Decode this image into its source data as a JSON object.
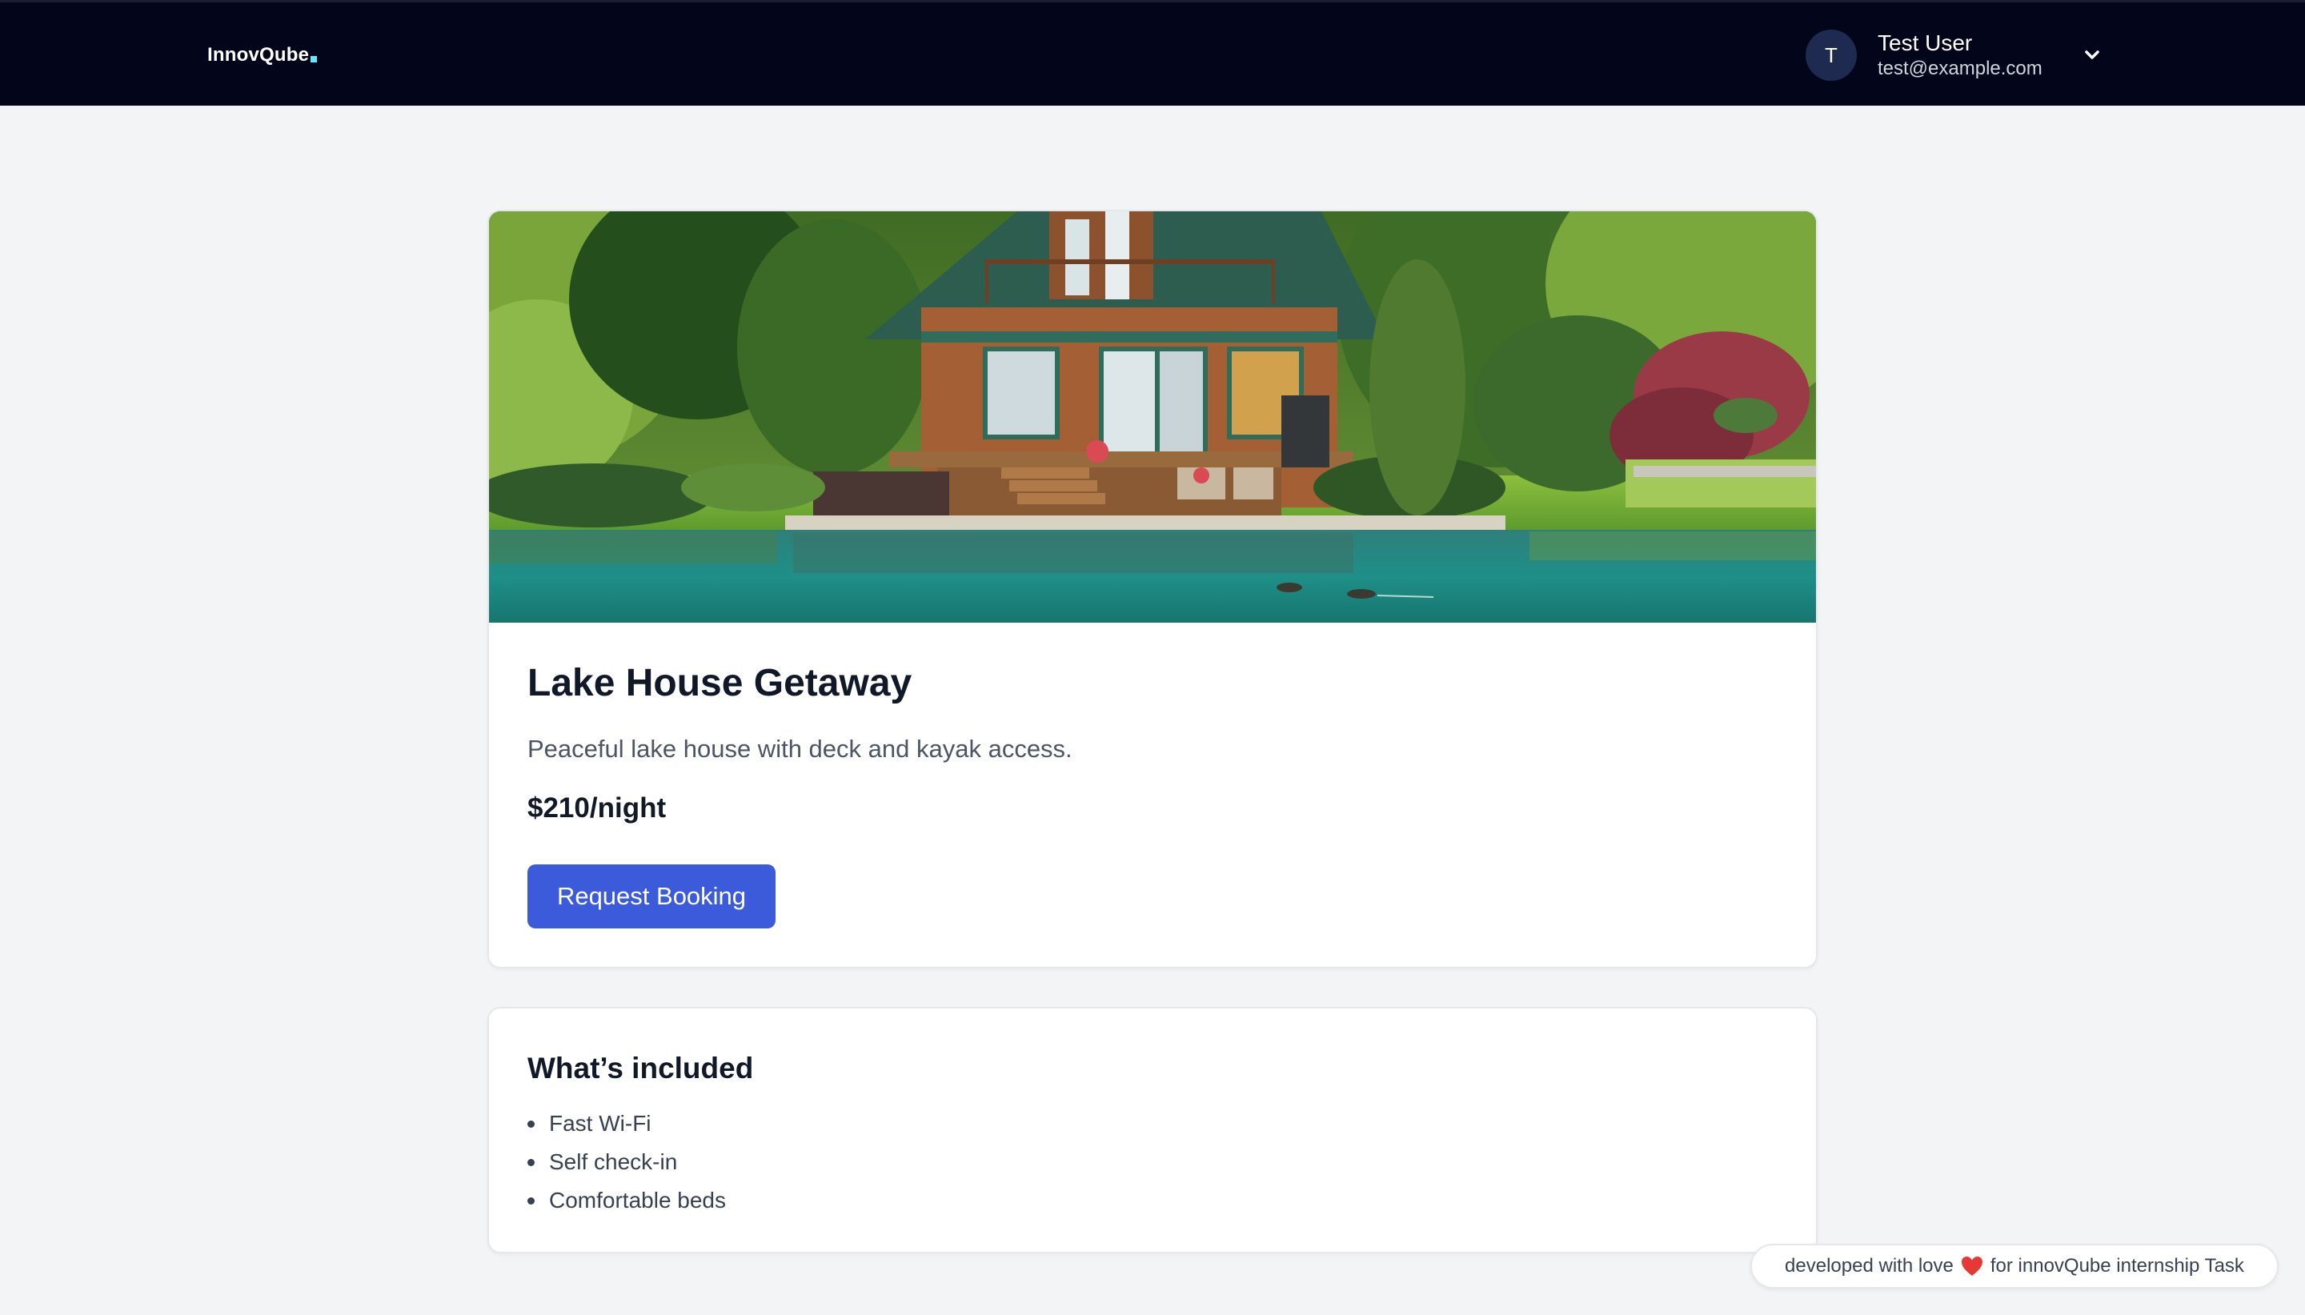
{
  "header": {
    "brand": "InnovQube",
    "brand_accent_color": "#67e8f9",
    "user": {
      "initial": "T",
      "name": "Test User",
      "email": "test@example.com"
    },
    "menu_icon": "chevron-down-icon"
  },
  "listing": {
    "image_subject": "lake-house-photo",
    "title": "Lake House Getaway",
    "description": "Peaceful lake house with deck and kayak access.",
    "price": "$210/night",
    "book_button": "Request Booking",
    "button_color": "#3b5bdb"
  },
  "included": {
    "title": "What’s included",
    "items": [
      "Fast Wi-Fi",
      "Self check-in",
      "Comfortable beds"
    ]
  },
  "footer": {
    "credit_before": "developed with love",
    "credit_icon": "heart-icon",
    "credit_after": "for innovQube internship Task"
  }
}
